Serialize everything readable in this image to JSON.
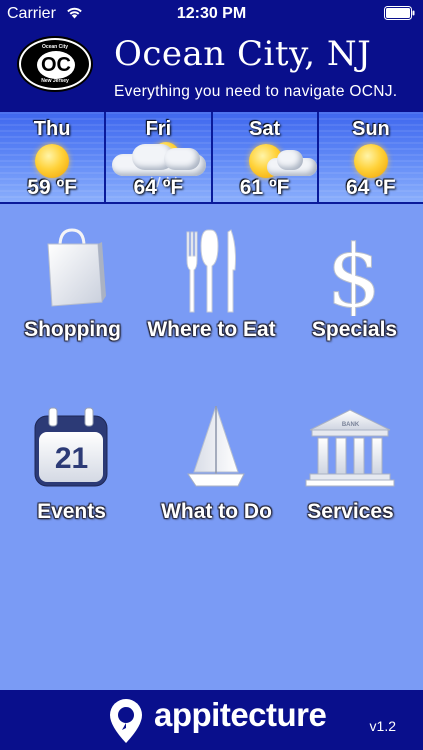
{
  "status_bar": {
    "carrier": "Carrier",
    "time": "12:30 PM"
  },
  "header": {
    "logo": {
      "top_text": "Ocean City",
      "main_text": "OC",
      "bottom_text": "New Jersey"
    },
    "title": "Ocean City, NJ",
    "subtitle": "Everything you need to navigate OCNJ."
  },
  "weather": {
    "days": [
      {
        "day": "Thu",
        "temp": "59 ºF",
        "icon": "sunny-icon"
      },
      {
        "day": "Fri",
        "temp": "64 ºF",
        "icon": "cloudy-rain-icon"
      },
      {
        "day": "Sat",
        "temp": "61 ºF",
        "icon": "partly-cloudy-icon"
      },
      {
        "day": "Sun",
        "temp": "64 ºF",
        "icon": "sunny-icon"
      }
    ]
  },
  "menu": {
    "items": [
      {
        "label": "Shopping",
        "icon": "shopping-bag-icon"
      },
      {
        "label": "Where to Eat",
        "icon": "utensils-icon"
      },
      {
        "label": "Specials",
        "icon": "dollar-icon"
      },
      {
        "label": "Events",
        "icon": "calendar-icon",
        "calendar_day": "21"
      },
      {
        "label": "What to Do",
        "icon": "sailboat-icon"
      },
      {
        "label": "Services",
        "icon": "bank-icon",
        "bank_text": "BANK"
      }
    ]
  },
  "footer": {
    "brand": "appitecture",
    "version": "v1.2"
  },
  "colors": {
    "header_bg": "#090f8c",
    "body_bg": "#7a9bf5",
    "weather_sky": "#5a84f5"
  }
}
